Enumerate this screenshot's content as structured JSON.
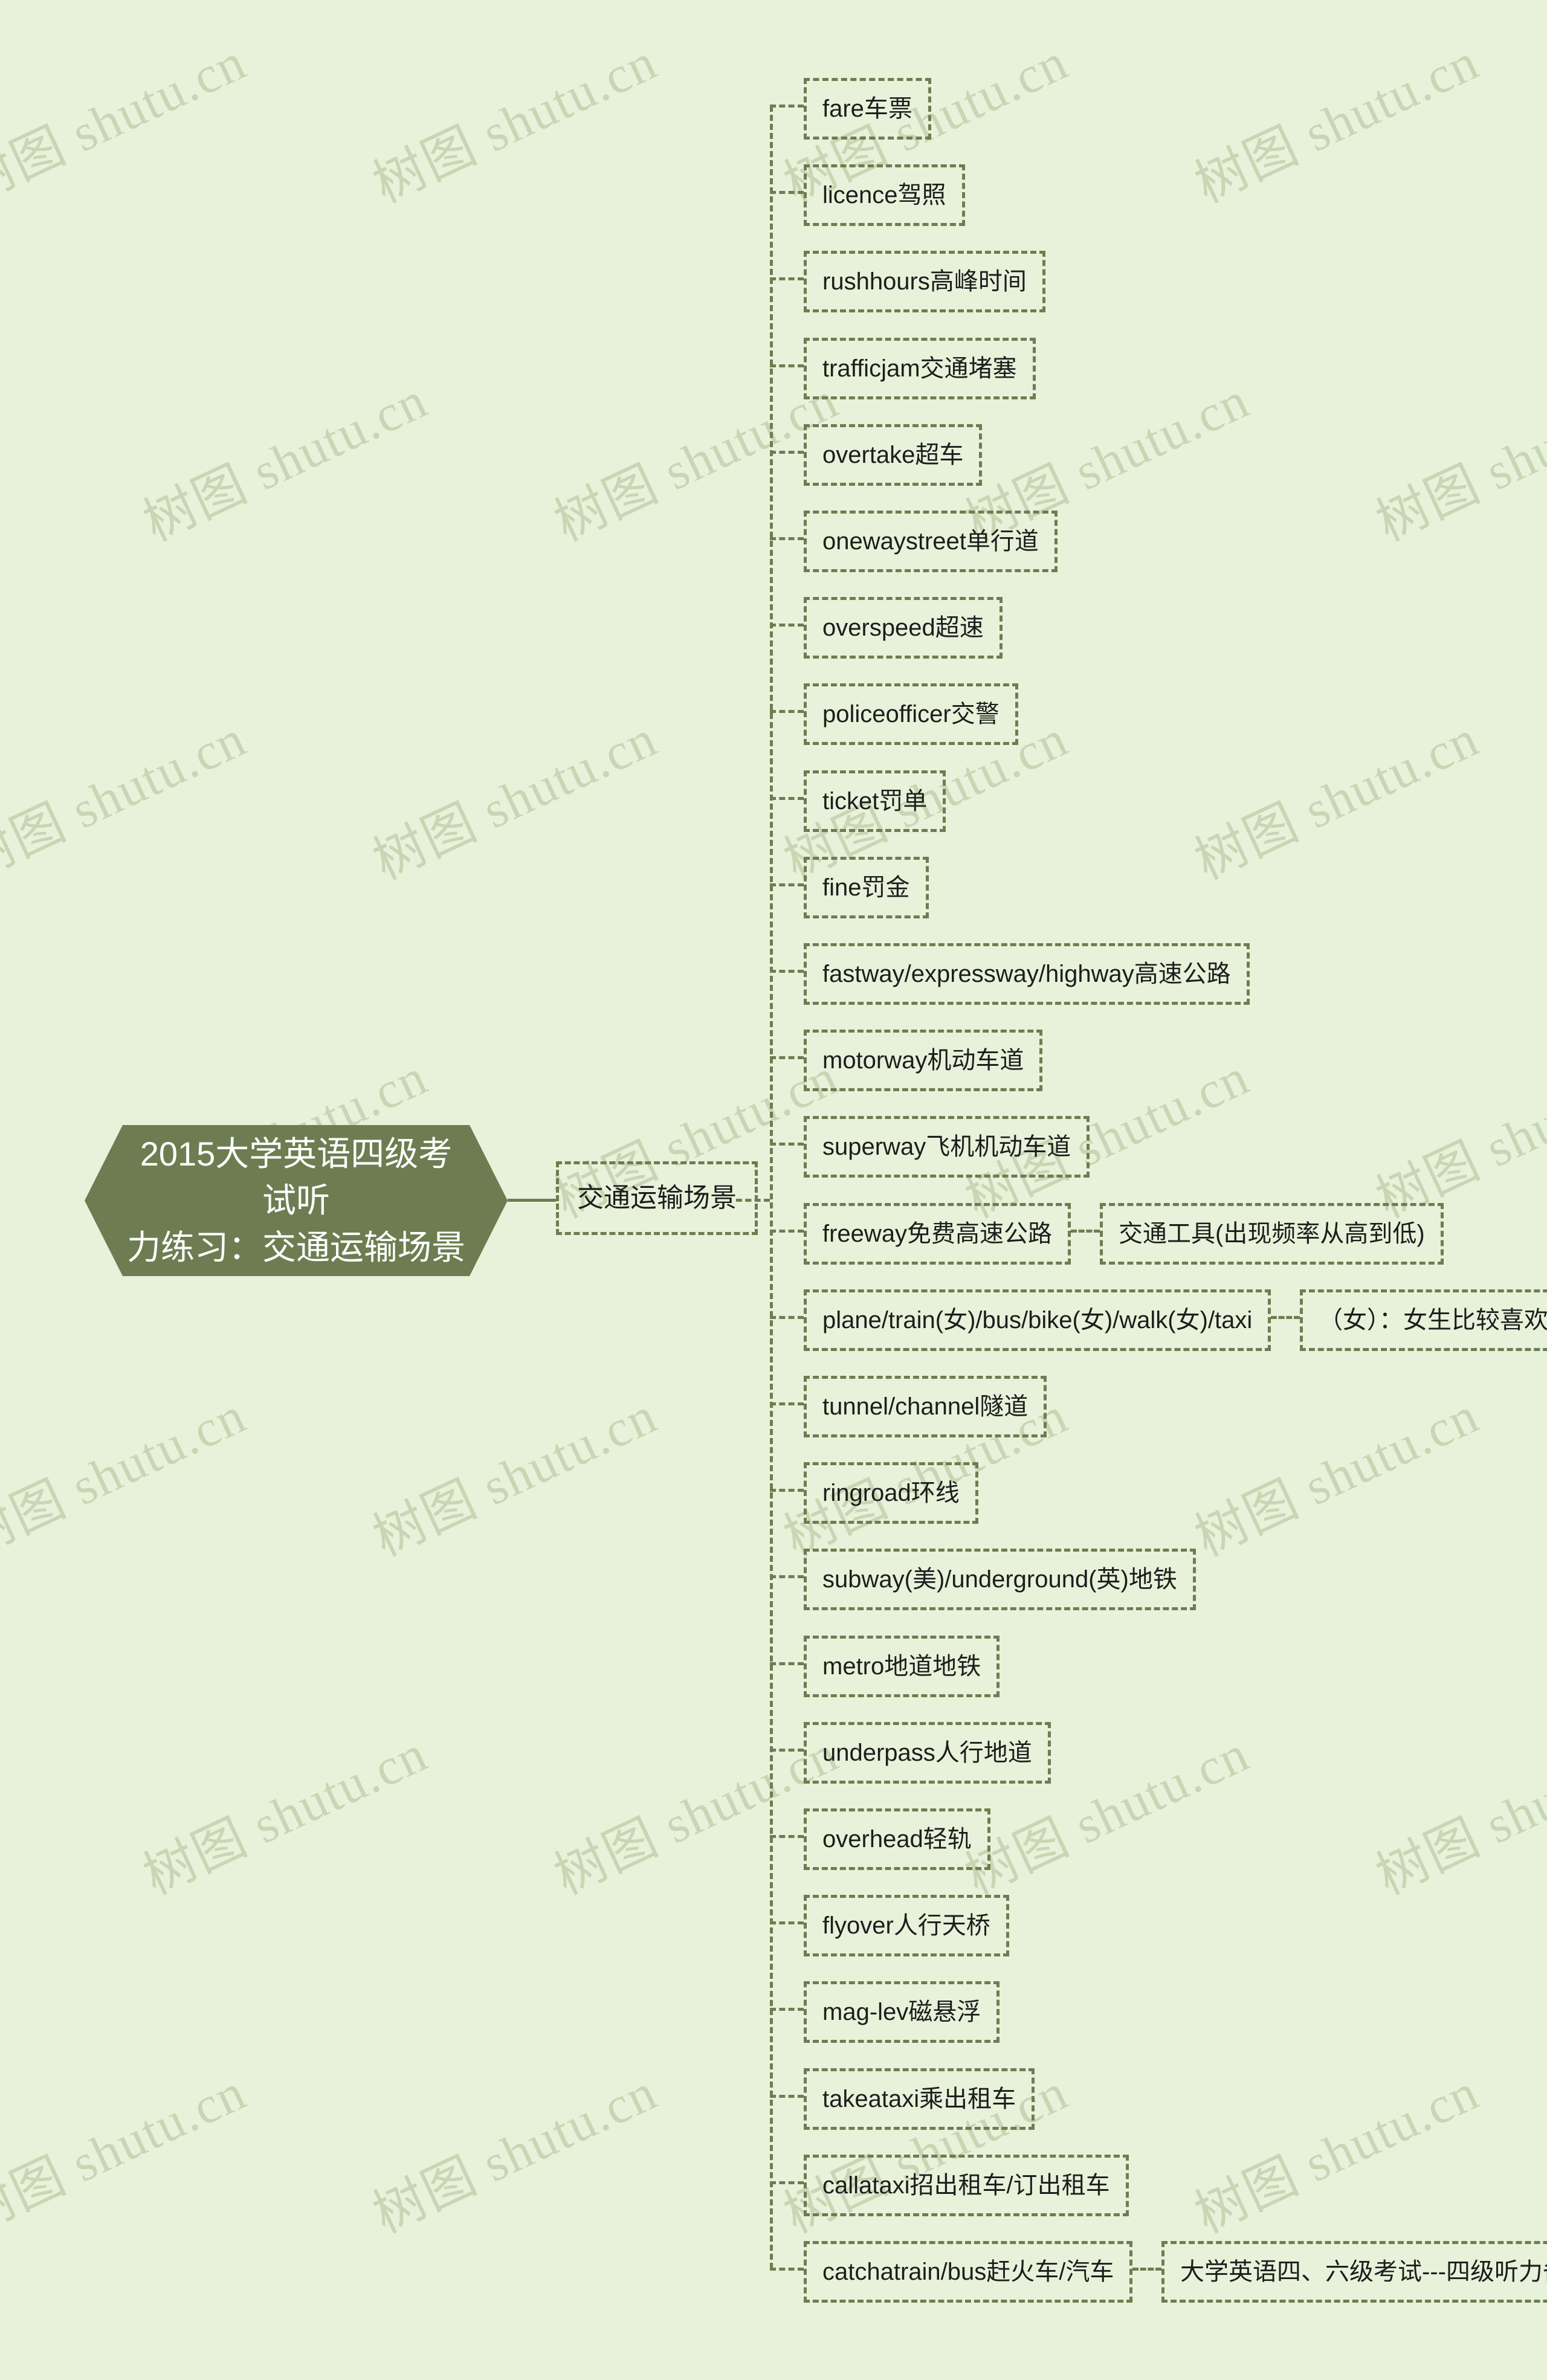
{
  "meta": {
    "diagram_type": "mind-map",
    "orientation": "left-to-right",
    "background_color": "#e8f2da",
    "root_fill_color": "#6d7d51",
    "root_text_color": "#ffffff",
    "node_border_color": "#6d7d51",
    "node_text_color": "#1d1d1d",
    "watermark_color": "#c9d6b4"
  },
  "watermark": {
    "text": "树图 shutu.cn",
    "rotation_deg": -25
  },
  "root": {
    "line1": "2015大学英语四级考试听",
    "line2": "力练习：交通运输场景"
  },
  "branch": {
    "label": "交通运输场景"
  },
  "leaves": [
    {
      "label": "fare车票"
    },
    {
      "label": "licence驾照"
    },
    {
      "label": "rushhours高峰时间"
    },
    {
      "label": "trafficjam交通堵塞"
    },
    {
      "label": "overtake超车"
    },
    {
      "label": "onewaystreet单行道"
    },
    {
      "label": "overspeed超速"
    },
    {
      "label": "policeofficer交警"
    },
    {
      "label": "ticket罚单"
    },
    {
      "label": "fine罚金"
    },
    {
      "label": "fastway/expressway/highway高速公路"
    },
    {
      "label": "motorway机动车道"
    },
    {
      "label": "superway飞机机动车道"
    },
    {
      "label": "freeway免费高速公路",
      "child": "交通工具(出现频率从高到低)"
    },
    {
      "label": "plane/train(女)/bus/bike(女)/walk(女)/taxi",
      "child": "（女）：女生比较喜欢"
    },
    {
      "label": "tunnel/channel隧道"
    },
    {
      "label": "ringroad环线"
    },
    {
      "label": "subway(美)/underground(英)地铁"
    },
    {
      "label": "metro地道地铁"
    },
    {
      "label": "underpass人行地道"
    },
    {
      "label": "overhead轻轨"
    },
    {
      "label": "flyover人行天桥"
    },
    {
      "label": "mag-lev磁悬浮"
    },
    {
      "label": "takeataxi乘出租车"
    },
    {
      "label": "callataxi招出租车/订出租车"
    },
    {
      "label": "catchatrain/bus赶火车/汽车",
      "child": "大学英语四、六级考试---四级听力备考资料"
    }
  ]
}
